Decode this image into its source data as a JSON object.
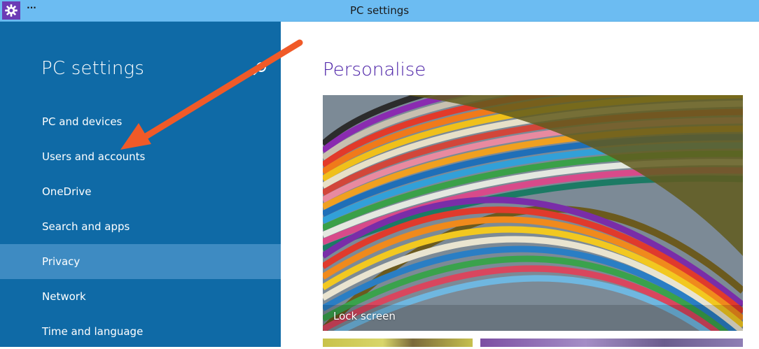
{
  "window": {
    "title": "PC settings",
    "menu_glyph": "..."
  },
  "sidebar": {
    "title": "PC settings",
    "items": [
      {
        "label": "PC and devices",
        "selected": false
      },
      {
        "label": "Users and accounts",
        "selected": false
      },
      {
        "label": "OneDrive",
        "selected": false
      },
      {
        "label": "Search and apps",
        "selected": false
      },
      {
        "label": "Privacy",
        "selected": true
      },
      {
        "label": "Network",
        "selected": false
      },
      {
        "label": "Time and language",
        "selected": false
      }
    ]
  },
  "content": {
    "title": "Personalise",
    "tiles": [
      {
        "caption": "Lock screen"
      }
    ]
  },
  "colors": {
    "titlebar": "#6cbcf2",
    "sidebar": "#0f6aa6",
    "sidebar_selected": "#3e8bc2",
    "accent_title": "#4a1fa6",
    "annotation_arrow": "#f05a28"
  },
  "icons": {
    "app": "gear-icon",
    "search": "search-icon"
  }
}
